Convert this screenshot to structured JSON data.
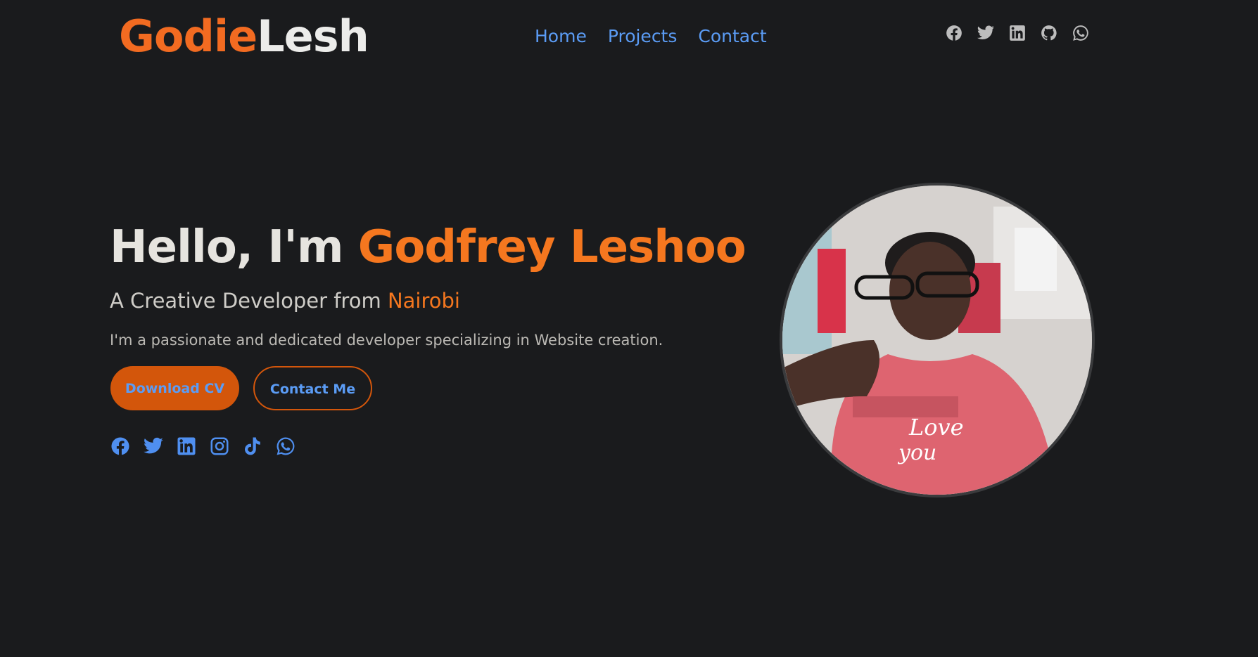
{
  "header": {
    "logo_first": "Godie",
    "logo_second": "Lesh",
    "nav": [
      {
        "label": "Home"
      },
      {
        "label": "Projects"
      },
      {
        "label": "Contact"
      }
    ],
    "social_icons": [
      "facebook-icon",
      "twitter-icon",
      "linkedin-icon",
      "github-icon",
      "whatsapp-icon"
    ]
  },
  "hero": {
    "title_prefix": "Hello, I'm ",
    "title_name": "Godfrey Leshoo",
    "subtitle_prefix": "A Creative Developer from ",
    "subtitle_city": "Nairobi",
    "description": "I'm a passionate and dedicated developer specializing in Website creation.",
    "download_cv_label": "Download CV",
    "contact_me_label": "Contact Me",
    "social_icons": [
      "facebook-icon",
      "twitter-icon",
      "linkedin-icon",
      "instagram-icon",
      "tiktok-icon",
      "whatsapp-icon"
    ]
  },
  "colors": {
    "background": "#1a1b1d",
    "accent_orange": "#f5771f",
    "button_orange": "#d3560b",
    "link_blue": "#5b9cf5",
    "text_light": "#e6e4df"
  }
}
